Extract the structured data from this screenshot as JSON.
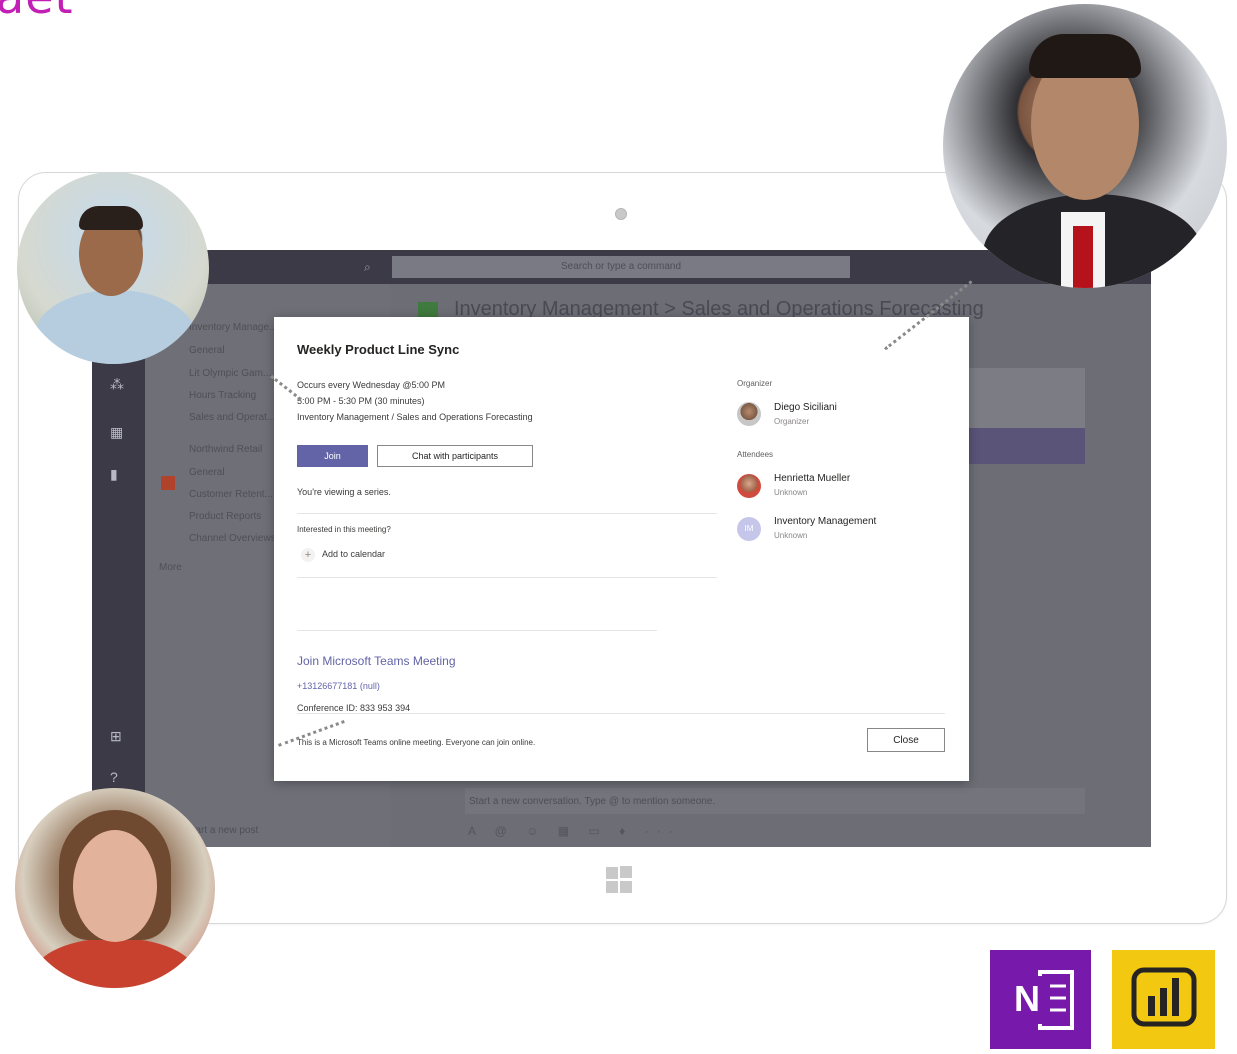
{
  "heading_fragment": "aet",
  "teams": {
    "search_placeholder": "Search or type a command",
    "channel_header": "Inventory Management  >  Sales and Operations Forecasting",
    "channels": [
      "Inventory Manage...",
      "General",
      "Lit Olympic Gam...",
      "Hours Tracking",
      "Sales and Operat...",
      "Northwind Retail",
      "General",
      "Customer Retent...",
      "Product Reports",
      "Channel Overviews",
      "More"
    ],
    "compose_placeholder": "Start a new conversation. Type @ to mention someone.",
    "start_post": "Start a new post",
    "compose_tools": "A  @  ☺  ▦  ▭  ♦  ···"
  },
  "meeting": {
    "title": "Weekly Product Line Sync",
    "recurrence": "Occurs every Wednesday @5:00 PM",
    "time": "5:00 PM - 5:30 PM (30 minutes)",
    "channel": "Inventory Management / Sales and Operations Forecasting",
    "join_label": "Join",
    "chat_label": "Chat with participants",
    "series_note": "You're viewing a series.",
    "interested_label": "Interested in this meeting?",
    "add_calendar_label": "Add to calendar",
    "join_link": "Join Microsoft Teams Meeting",
    "phone": "+13126677181 (null)",
    "conference": "Conference ID: 833 953 394",
    "footer_note": "This is a Microsoft Teams online meeting. Everyone can join online.",
    "close_label": "Close",
    "organizer_heading": "Organizer",
    "organizer": {
      "name": "Diego Siciliani",
      "role": "Organizer"
    },
    "attendees_heading": "Attendees",
    "attendees": [
      {
        "name": "Henrietta Mueller",
        "role": "Unknown",
        "initials": ""
      },
      {
        "name": "Inventory Management",
        "role": "Unknown",
        "initials": "IM"
      }
    ]
  },
  "icons": {
    "onenote_letter": "N",
    "powerbi": "bar-chart-icon"
  },
  "colors": {
    "teams_purple": "#6264a7",
    "onenote": "#7719aa",
    "powerbi": "#f2c811",
    "heading": "#c21fb5"
  }
}
